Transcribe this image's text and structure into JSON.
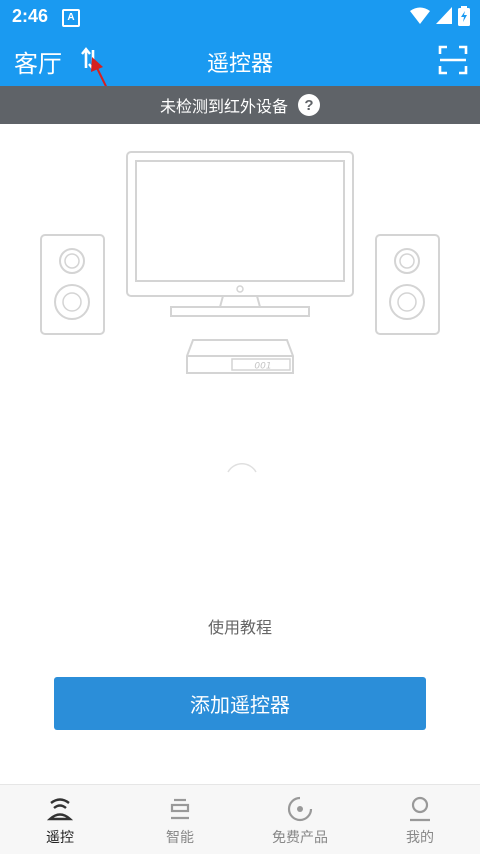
{
  "status": {
    "time": "2:46",
    "notification_glyph": "A"
  },
  "header": {
    "room": "客厅",
    "title": "遥控器"
  },
  "banner": {
    "text": "未检测到红外设备",
    "help_glyph": "?"
  },
  "device": {
    "box_display": "001"
  },
  "tutorial_label": "使用教程",
  "add_button_label": "添加遥控器",
  "nav": {
    "items": [
      {
        "label": "遥控",
        "icon": "remote-icon",
        "active": true
      },
      {
        "label": "智能",
        "icon": "smart-device-icon",
        "active": false
      },
      {
        "label": "免费产品",
        "icon": "target-icon",
        "active": false
      },
      {
        "label": "我的",
        "icon": "profile-icon",
        "active": false
      }
    ]
  },
  "colors": {
    "primary": "#1a9af1",
    "banner": "#5f6368",
    "button": "#2b8ed9",
    "annotation_arrow": "#d62020"
  }
}
